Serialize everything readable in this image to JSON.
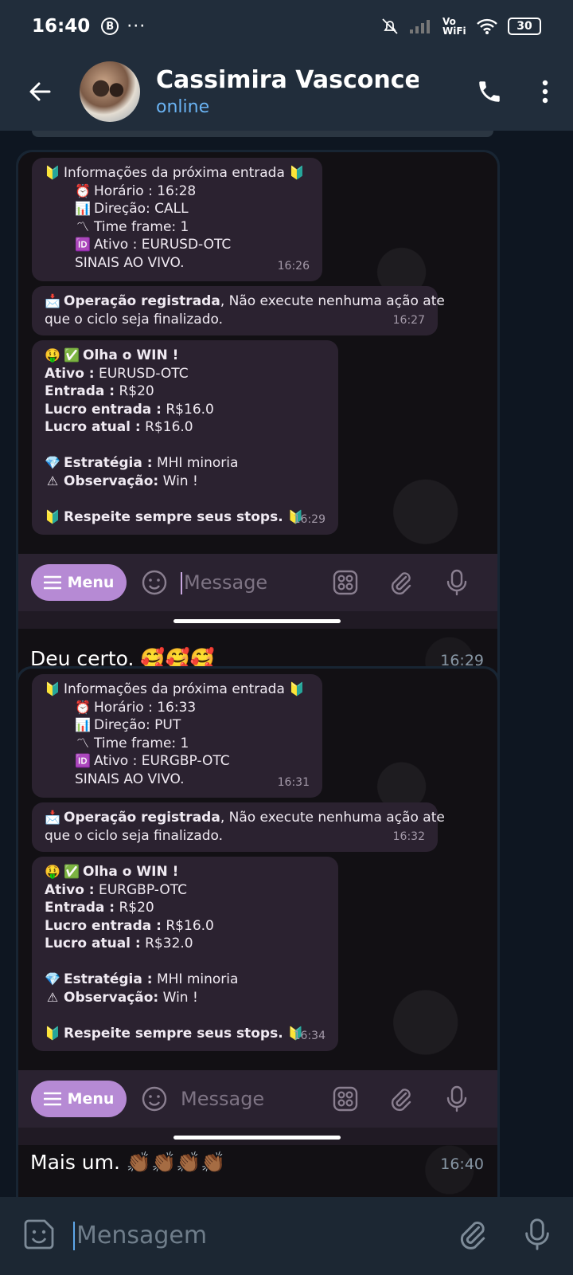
{
  "status_bar": {
    "time": "16:40",
    "b_label": "B",
    "dots": "···",
    "vowifi": "Vo WiFi",
    "battery": "30"
  },
  "header": {
    "name": "Cassimira Vasconcelos",
    "status": "online"
  },
  "posts": [
    {
      "info": {
        "title": "Informações da próxima entrada",
        "horario": "Horário : 16:28",
        "direcao": "Direção: CALL",
        "timeframe": "Time frame: 1",
        "ativo": "Ativo : EURUSD-OTC",
        "sinais": "SINAIS AO VIVO.",
        "time": "16:26"
      },
      "op": {
        "bold": "Operação registrada",
        "rest": ", Não execute nenhuma ação ate",
        "line2": "que o ciclo seja finalizado.",
        "time": "16:27"
      },
      "win": {
        "title": "Olha o WIN !",
        "ativo_label": "Ativo :",
        "ativo": " EURUSD-OTC",
        "entrada_label": "Entrada :",
        "entrada": " R$20",
        "lucro_entrada_label": "Lucro entrada :",
        "lucro_entrada": " R$16.0",
        "lucro_atual_label": "Lucro atual :",
        "lucro_atual": " R$16.0",
        "estrategia_label": "Estratégia :",
        "estrategia": " MHI minoria",
        "observacao_label": "Observação:",
        "observacao": " Win !",
        "stops": "Respeite sempre seus stops.",
        "time": "16:29"
      },
      "composer": {
        "menu": "Menu",
        "placeholder": "Message"
      },
      "caption": "Deu certo. 🥰🥰🥰",
      "caption_time": "16:29"
    },
    {
      "info": {
        "title": "Informações da próxima entrada",
        "horario": "Horário : 16:33",
        "direcao": "Direção: PUT",
        "timeframe": "Time frame: 1",
        "ativo": "Ativo : EURGBP-OTC",
        "sinais": "SINAIS AO VIVO.",
        "time": "16:31"
      },
      "op": {
        "bold": "Operação registrada",
        "rest": ", Não execute nenhuma ação ate",
        "line2": "que o ciclo seja finalizado.",
        "time": "16:32"
      },
      "win": {
        "title": "Olha o WIN !",
        "ativo_label": "Ativo :",
        "ativo": " EURGBP-OTC",
        "entrada_label": "Entrada :",
        "entrada": " R$20",
        "lucro_entrada_label": "Lucro entrada :",
        "lucro_entrada": " R$16.0",
        "lucro_atual_label": "Lucro atual :",
        "lucro_atual": " R$32.0",
        "estrategia_label": "Estratégia :",
        "estrategia": " MHI minoria",
        "observacao_label": "Observação:",
        "observacao": " Win !",
        "stops": "Respeite sempre seus stops.",
        "time": "16:34"
      },
      "composer": {
        "menu": "Menu",
        "placeholder": "Message"
      },
      "caption": "Mais um. 👏🏾👏🏾👏🏾👏🏾",
      "caption_time": "16:40"
    }
  ],
  "input": {
    "placeholder": "Mensagem"
  },
  "colors": {
    "accent": "#6ab3f3",
    "menu_button": "#b68ad4",
    "bubble": "#182533"
  }
}
